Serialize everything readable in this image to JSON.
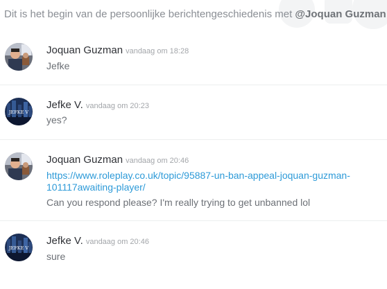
{
  "intro": {
    "prefix": "Dit is het begin van de persoonlijke berichtengeschiedenis met ",
    "mention": "@Joquan Guzman",
    "suffix": "."
  },
  "messages": [
    {
      "username": "Joquan Guzman",
      "timestamp": "vandaag om 18:28",
      "lines": [
        "Jefke"
      ]
    },
    {
      "username": "Jefke V.",
      "timestamp": "vandaag om 20:23",
      "avatar_text": "JEFKE V",
      "lines": [
        "yes?"
      ]
    },
    {
      "username": "Joquan Guzman",
      "timestamp": "vandaag om 20:46",
      "link_line1": "https://www.roleplay.co.uk/topic/95887-un-ban-appeal-joquan-guzman-",
      "link_line2": "101117awaiting-player/",
      "lines": [
        "Can you respond please? I'm really trying to get unbanned lol"
      ]
    },
    {
      "username": "Jefke V.",
      "timestamp": "vandaag om 20:46",
      "avatar_text": "JEFKE V",
      "lines": [
        "sure"
      ]
    }
  ],
  "colors": {
    "username": "#2f3136",
    "timestamp": "#a3a6aa",
    "body_text": "#6c7076",
    "link": "#2d9ad8",
    "divider": "#eceeef"
  },
  "icons": {
    "avatar_joquan": "user-photo-avatar",
    "avatar_jefke": "city-skyline-avatar"
  }
}
